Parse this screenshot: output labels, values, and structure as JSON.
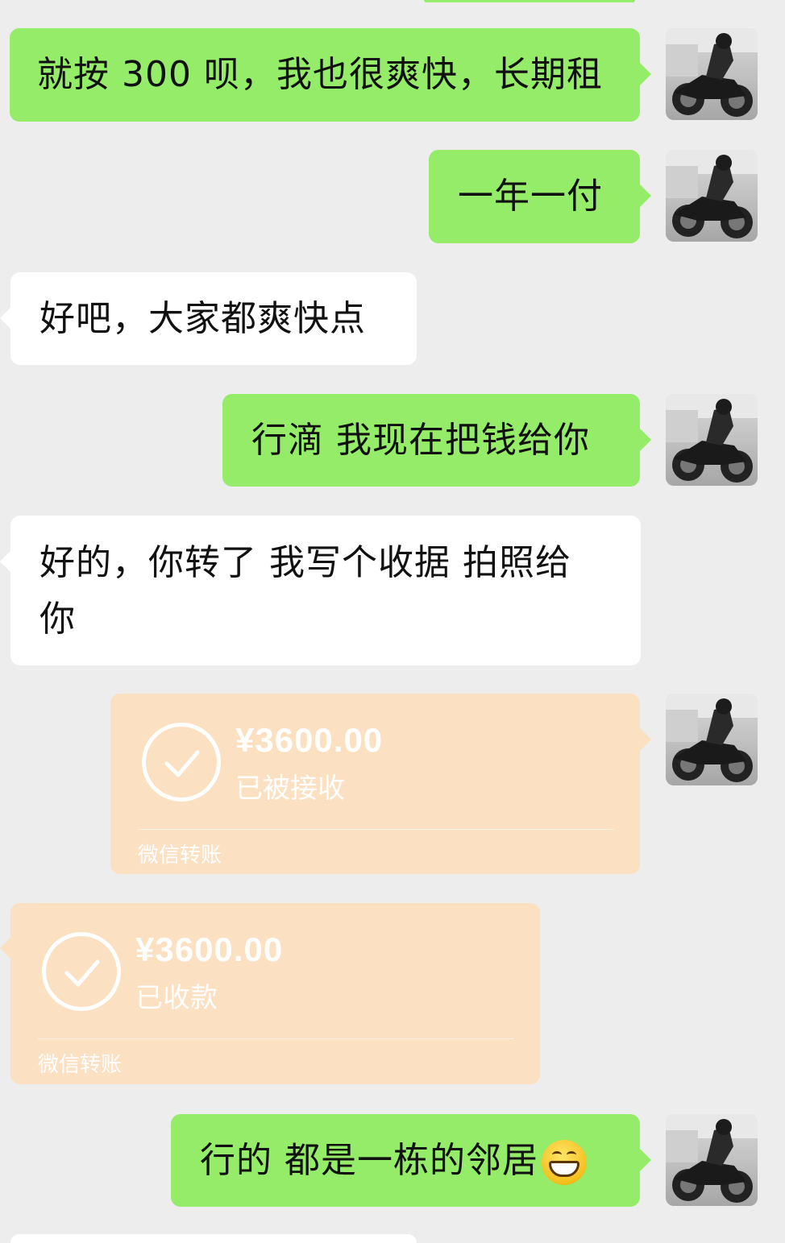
{
  "colors": {
    "background": "#ededed",
    "sent_bubble": "#95ec69",
    "received_bubble": "#ffffff",
    "transfer_card": "#fce0c2"
  },
  "messages": [
    {
      "side": "me",
      "text": "就按 300 呗，我也很爽快，长期租"
    },
    {
      "side": "me",
      "text": "一年一付"
    },
    {
      "side": "other",
      "text": "好吧，大家都爽快点"
    },
    {
      "side": "me",
      "text": "行滴 我现在把钱给你"
    },
    {
      "side": "other",
      "text_line1": "好的，你转了 我写个收据 拍照给",
      "text_line2": "你"
    },
    {
      "side": "me",
      "type": "transfer",
      "amount": "¥3600.00",
      "status": "已被接收",
      "footer": "微信转账",
      "icon": "check-circle-icon"
    },
    {
      "side": "other",
      "type": "transfer",
      "amount": "¥3600.00",
      "status": "已收款",
      "footer": "微信转账",
      "icon": "check-circle-icon"
    },
    {
      "side": "me",
      "text": "行的 都是一栋的邻居",
      "emoji": "grinning-face-icon"
    }
  ]
}
